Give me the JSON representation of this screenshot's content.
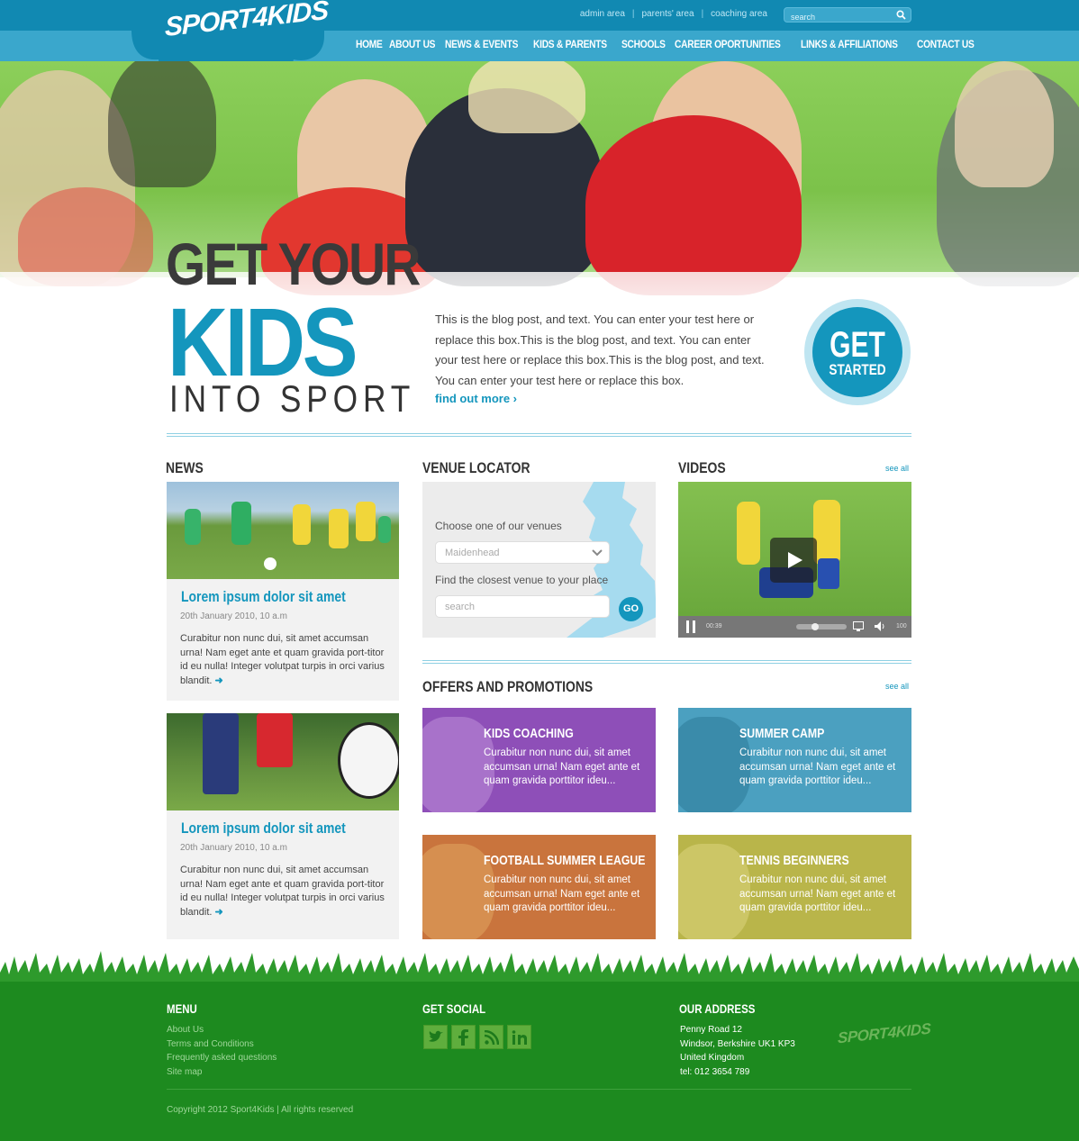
{
  "header": {
    "logo": "SPORT4KIDS",
    "top_links": [
      "admin area",
      "parents' area",
      "coaching area"
    ],
    "search_placeholder": "search",
    "nav": [
      "HOME",
      "ABOUT US",
      "NEWS & EVENTS",
      "KIDS & PARENTS",
      "SCHOOLS",
      "CAREER OPORTUNITIES",
      "LINKS & AFFILIATIONS",
      "CONTACT US"
    ]
  },
  "hero": {
    "line1": "GET YOUR",
    "line2": "KIDS",
    "line3": "INTO SPORT",
    "blurb": "This is the blog post, and text. You can enter your test here or replace this box.This is the blog post, and text. You can enter your test here or replace this box.This is the blog post, and text. You can enter your test here or replace this box.",
    "link": "find out more",
    "cta_line1": "GET",
    "cta_line2": "STARTED"
  },
  "news": {
    "title": "NEWS",
    "items": [
      {
        "title": "Lorem ipsum dolor sit amet",
        "date": "20th January 2010, 10 a.m",
        "body": "Curabitur non nunc dui, sit amet accumsan urna! Nam eget ante et quam gravida port-titor id eu nulla! Integer volutpat turpis in orci varius blandit."
      },
      {
        "title": "Lorem ipsum dolor sit amet",
        "date": "20th January 2010, 10 a.m",
        "body": "Curabitur non nunc dui, sit amet accumsan urna! Nam eget ante et quam gravida port-titor id eu nulla! Integer volutpat turpis in orci varius blandit."
      }
    ]
  },
  "venue": {
    "title": "VENUE LOCATOR",
    "choose_label": "Choose one of our venues",
    "selected": "Maidenhead",
    "closest_label": "Find the closest venue to your place",
    "search_placeholder": "search",
    "go": "GO"
  },
  "videos": {
    "title": "VIDEOS",
    "see_all": "see all",
    "elapsed": "00:39",
    "volume_label": "100"
  },
  "offers": {
    "title": "OFFERS AND PROMOTIONS",
    "see_all": "see all",
    "items": [
      {
        "title": "KIDS COACHING",
        "text": "Curabitur non nunc dui, sit amet accumsan urna! Nam eget ante et quam gravida porttitor ideu...",
        "color": "#8e4fb8"
      },
      {
        "title": "SUMMER CAMP",
        "text": "Curabitur non nunc dui, sit amet accumsan urna! Nam eget ante et quam gravida porttitor ideu...",
        "color": "#4ba0c0"
      },
      {
        "title": "FOOTBALL SUMMER LEAGUE",
        "text": "Curabitur non nunc dui, sit amet accumsan urna! Nam eget ante et quam gravida porttitor ideu...",
        "color": "#c9743d"
      },
      {
        "title": "TENNIS BEGINNERS",
        "text": "Curabitur non nunc dui, sit amet accumsan urna! Nam eget ante et quam gravida porttitor ideu...",
        "color": "#b9b54a"
      }
    ]
  },
  "footer": {
    "menu_title": "MENU",
    "menu": [
      "About Us",
      "Terms and Conditions",
      "Frequently asked questions",
      "Site map"
    ],
    "social_title": "GET SOCIAL",
    "social": [
      "twitter-icon",
      "facebook-icon",
      "rss-icon",
      "linkedin-icon"
    ],
    "address_title": "OUR ADDRESS",
    "address": [
      "Penny Road 12",
      "Windsor, Berkshire UK1 KP3",
      "United Kingdom",
      "tel: 012 3654 789"
    ],
    "logo": "SPORT4KIDS",
    "copyright": "Copyright 2012 Sport4Kids | All rights reserved"
  },
  "colors": {
    "brand_blue": "#1496bd",
    "nav_blue": "#3aa7cc",
    "footer_green": "#1d8a1f"
  }
}
